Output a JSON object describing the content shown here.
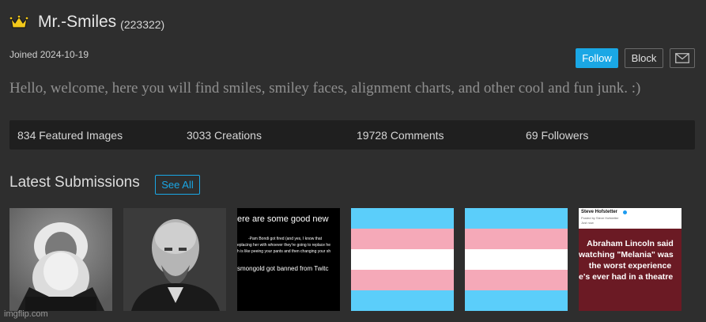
{
  "profile": {
    "username": "Mr.-Smiles",
    "points": "(223322)",
    "joined": "Joined 2024-10-19",
    "bio": "Hello, welcome, here you will find smiles, smiley faces, alignment charts, and other cool and fun junk. :)"
  },
  "actions": {
    "follow_label": "Follow",
    "block_label": "Block",
    "message_icon": "envelope-icon"
  },
  "stats": {
    "featured": "834 Featured Images",
    "creations": "3033 Creations",
    "comments": "19728 Comments",
    "followers": "69 Followers"
  },
  "submissions": {
    "title": "Latest Submissions",
    "see_all_label": "See All",
    "thumb3_lines": [
      "ere are some good new",
      "-Pam Bondi got fired (and yes, I know that",
      "eplacing her with whoever they're going to replace he",
      "h is like peeing your pants and then changing your sh",
      "smongold got banned from Twitc"
    ],
    "thumb6": {
      "author": "Steve Hofstetter",
      "posted": "Posted by Steve Hofstetter",
      "time": "Just now",
      "lines": [
        "Abraham Lincoln said",
        "watching \"Melania\" was",
        "the worst experience",
        "e's ever had in a theatre"
      ]
    }
  },
  "watermark": "imgflip.com",
  "colors": {
    "background": "#2e2e2e",
    "accent": "#1aa7e5",
    "stats_bar": "#1f1f1f",
    "flag_blue": "#5bcefa",
    "flag_pink": "#f5a9b8",
    "flag_white": "#ffffff",
    "post_red": "#6b1a24"
  }
}
